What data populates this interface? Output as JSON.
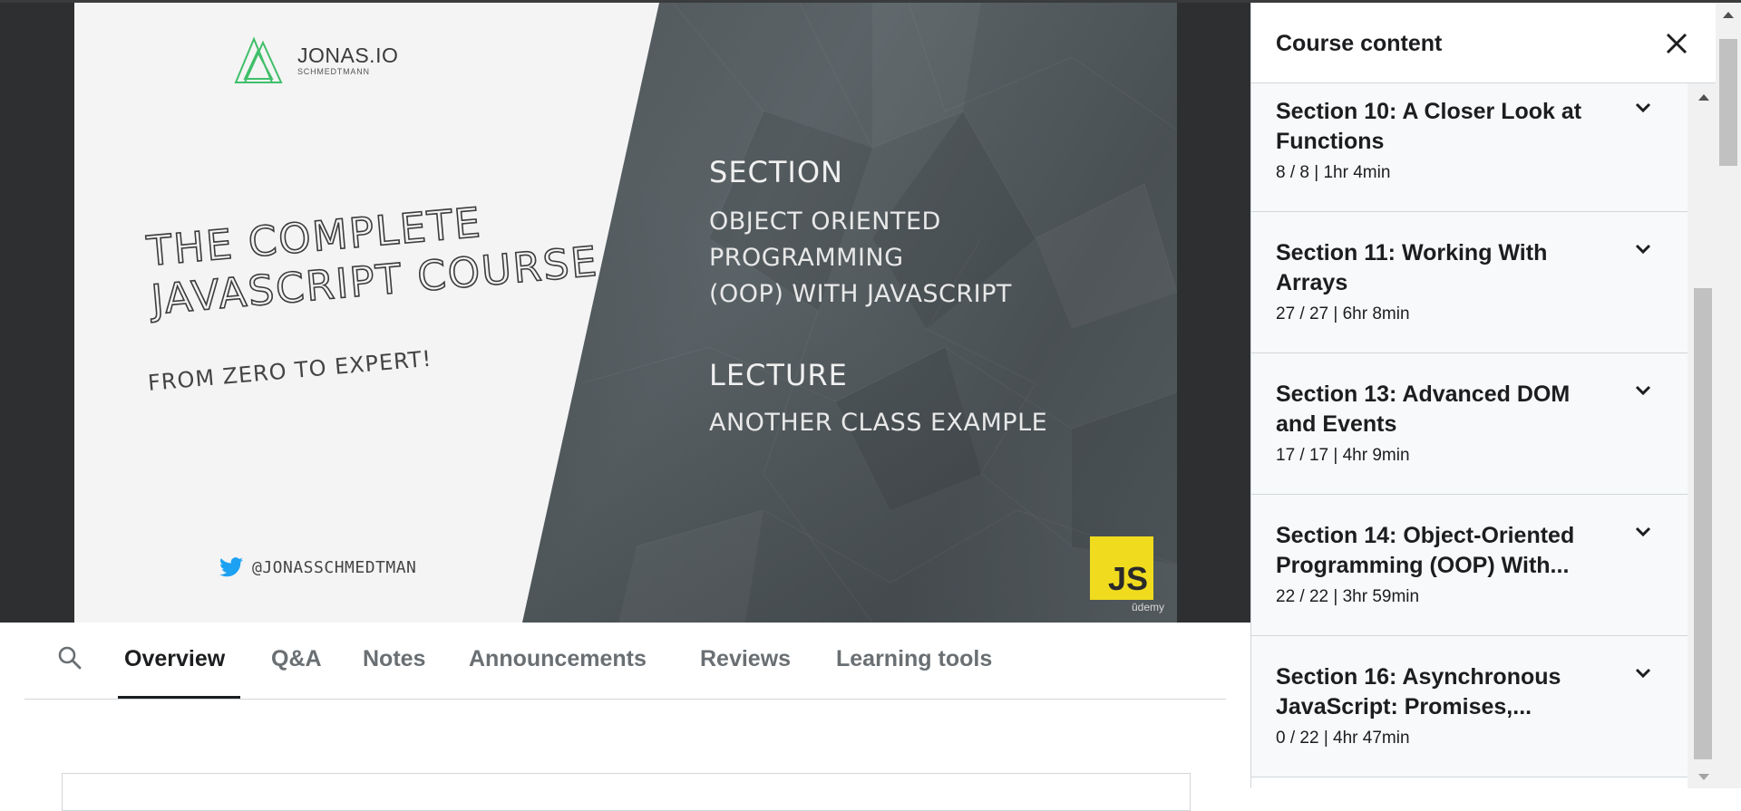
{
  "slide": {
    "logo_main": "JONAS.IO",
    "logo_sub": "SCHMEDTMANN",
    "course_title_line1": "THE COMPLETE",
    "course_title_line2": "JAVASCRIPT COURSE",
    "course_subtitle": "FROM ZERO TO EXPERT!",
    "twitter_handle": "@JONASSCHMEDTMAN",
    "section_label": "SECTION",
    "section_name_line1": "OBJECT ORIENTED PROGRAMMING",
    "section_name_line2": "(OOP) WITH JAVASCRIPT",
    "lecture_label": "LECTURE",
    "lecture_name": "ANOTHER CLASS EXAMPLE",
    "js_badge": "JS",
    "watermark": "ūdemy"
  },
  "tabs": {
    "search_icon": "search-icon",
    "items": [
      {
        "label": "Overview",
        "active": true
      },
      {
        "label": "Q&A"
      },
      {
        "label": "Notes"
      },
      {
        "label": "Announcements"
      },
      {
        "label": "Reviews"
      },
      {
        "label": "Learning tools"
      }
    ]
  },
  "sidebar": {
    "title": "Course content",
    "close_icon": "close-icon",
    "sections": [
      {
        "title": "Section 10: A Closer Look at Functions",
        "meta": "8 / 8 | 1hr 4min"
      },
      {
        "title": "Section 11: Working With Arrays",
        "meta": "27 / 27 | 6hr 8min"
      },
      {
        "title": "Section 13: Advanced DOM and Events",
        "meta": "17 / 17 | 4hr 9min"
      },
      {
        "title": "Section 14: Object-Oriented Programming (OOP) With...",
        "meta": "22 / 22 | 3hr 59min"
      },
      {
        "title": "Section 16: Asynchronous JavaScript: Promises,...",
        "meta": "0 / 22 | 4hr 47min"
      }
    ]
  },
  "colors": {
    "accent_text": "#1c1d1f",
    "muted_text": "#6a6f73",
    "js_yellow": "#f0db1e",
    "twitter_blue": "#1da1f2",
    "logo_green": "#3fbf6a"
  }
}
